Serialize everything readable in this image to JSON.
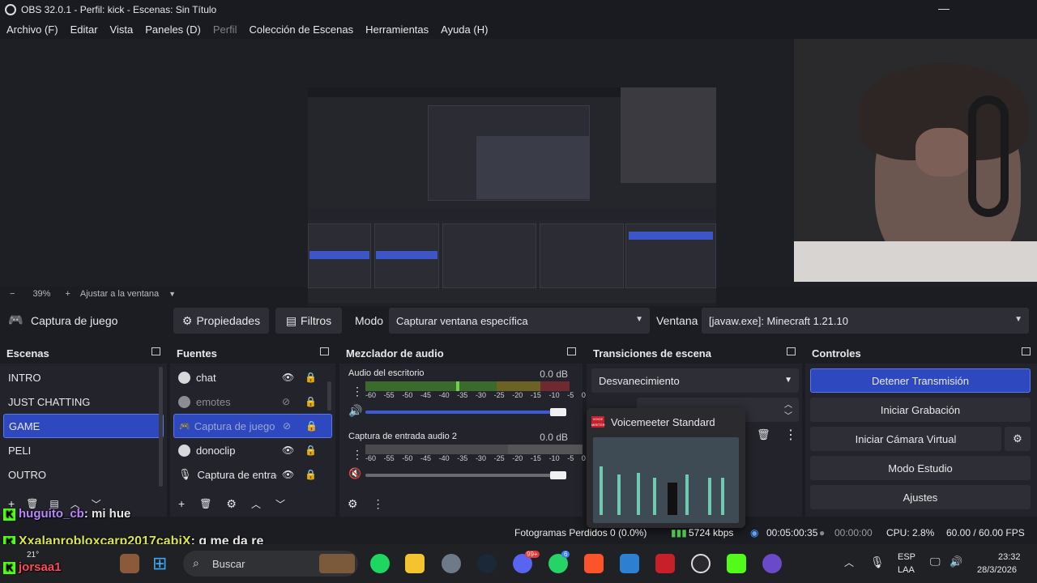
{
  "window": {
    "title": "OBS 32.0.1 - Perfil: kick - Escenas: Sin Título"
  },
  "menu": [
    "Archivo (F)",
    "Editar",
    "Vista",
    "Paneles (D)",
    "Perfil",
    "Colección de Escenas",
    "Herramientas",
    "Ayuda (H)"
  ],
  "zoom": {
    "minus": "−",
    "value": "39%",
    "plus": "+",
    "fit_label": "Ajustar a la ventana",
    "chevron": "▼"
  },
  "source_toolbar": {
    "source_name": "Captura de juego",
    "properties_label": "Propiedades",
    "filters_label": "Filtros",
    "mode_label": "Modo",
    "mode_value": "Capturar ventana específica",
    "window_label": "Ventana",
    "window_value": "[javaw.exe]: Minecraft 1.21.10"
  },
  "scenes": {
    "title": "Escenas",
    "items": [
      "INTRO",
      "JUST CHATTING",
      "GAME",
      "PELI",
      "OUTRO"
    ],
    "selected_index": 2
  },
  "sources": {
    "title": "Fuentes",
    "items": [
      {
        "label": "chat",
        "visible": true
      },
      {
        "label": "emotes",
        "visible": false
      },
      {
        "label": "Captura de juego",
        "visible": false
      },
      {
        "label": "donoclip",
        "visible": true
      },
      {
        "label": "Captura de entrada audio 2",
        "visible": true
      }
    ],
    "selected_index": 2
  },
  "mixer": {
    "title": "Mezclador de audio",
    "channels": [
      {
        "name": "Audio del escritorio",
        "db": "0.0 dB",
        "muted": false
      },
      {
        "name": "Captura de entrada audio 2",
        "db": "0.0 dB",
        "muted": true
      }
    ],
    "scale": [
      "-60",
      "-55",
      "-50",
      "-45",
      "-40",
      "-35",
      "-30",
      "-25",
      "-20",
      "-15",
      "-10",
      "-5",
      "0"
    ]
  },
  "transitions": {
    "title": "Transiciones de escena",
    "selected": "Desvanecimiento"
  },
  "controls": {
    "title": "Controles",
    "stop_stream": "Detener Transmisión",
    "start_recording": "Iniciar Grabación",
    "start_virtual_cam": "Iniciar Cámara Virtual",
    "studio_mode": "Modo Estudio",
    "settings": "Ajustes"
  },
  "voicemeeter": {
    "badge": "VOICE MEETER",
    "title": "Voicemeeter Standard"
  },
  "status": {
    "dropped_frames": "Fotogramas Perdidos 0 (0.0%)",
    "bitrate": "5724 kbps",
    "stream_time": "00:05:00:35",
    "rec_time": "00:00:00",
    "cpu": "CPU: 2.8%",
    "fps": "60.00 / 60.00 FPS"
  },
  "chat": {
    "line1_user": "huguito_cb",
    "line1_msg": ": mi hue",
    "line2_user": "Xxalanrobloxcarp2017cabjX",
    "line2_msg": ": q me da re",
    "line3_user": "jorsaa1"
  },
  "taskbar": {
    "weather_temp": "21°",
    "search_placeholder": "Buscar",
    "lang1": "ESP",
    "lang2": "LAA",
    "time": "23:32",
    "date": "28/3/2026",
    "discord_badge": "99+",
    "whatsapp_badge": "6"
  },
  "colors": {
    "accent_blue": "#2e48c0",
    "kick_green": "#53fc18",
    "chat_purple": "#b886ff",
    "panel_bg": "#23242b"
  }
}
